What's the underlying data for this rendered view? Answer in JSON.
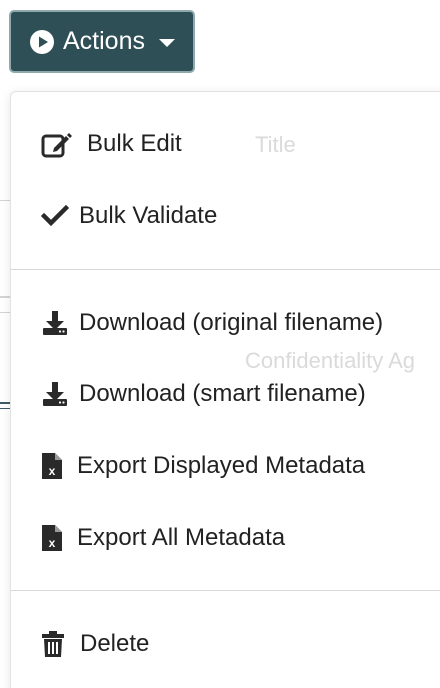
{
  "toolbar": {
    "actions_label": "Actions",
    "button_color": "#2f4f57"
  },
  "background": {
    "title_header": "Title",
    "row_text": "Confidentiality Ag"
  },
  "menu": {
    "items": [
      {
        "label": "Bulk Edit",
        "icon": "edit-icon"
      },
      {
        "label": "Bulk Validate",
        "icon": "check-icon"
      },
      {
        "label": "Download (original filename)",
        "icon": "download-icon"
      },
      {
        "label": "Download (smart filename)",
        "icon": "download-icon"
      },
      {
        "label": "Export Displayed Metadata",
        "icon": "excel-file-icon"
      },
      {
        "label": "Export All Metadata",
        "icon": "excel-file-icon"
      },
      {
        "label": "Delete",
        "icon": "trash-icon"
      }
    ]
  }
}
